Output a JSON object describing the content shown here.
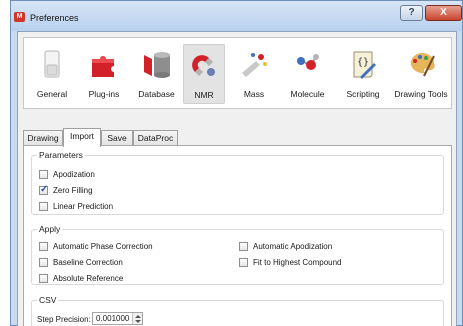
{
  "window": {
    "title": "Preferences",
    "app_icon": "mnova-app-icon",
    "help_label": "?",
    "close_label": "X"
  },
  "categories": [
    {
      "label": "General",
      "icon": "switch-icon"
    },
    {
      "label": "Plug-ins",
      "icon": "puzzle-icon"
    },
    {
      "label": "Database",
      "icon": "database-icon"
    },
    {
      "label": "NMR",
      "icon": "magnet-icon",
      "selected": true
    },
    {
      "label": "Mass",
      "icon": "mass-spec-icon"
    },
    {
      "label": "Molecule",
      "icon": "molecule-icon"
    },
    {
      "label": "Scripting",
      "icon": "script-icon"
    },
    {
      "label": "Drawing Tools",
      "icon": "palette-icon"
    }
  ],
  "tabs": [
    {
      "label": "Drawing",
      "active": false
    },
    {
      "label": "Import",
      "active": true
    },
    {
      "label": "Save",
      "active": false
    },
    {
      "label": "DataProc",
      "active": false
    }
  ],
  "parameters": {
    "title": "Parameters",
    "items": [
      {
        "label": "Apodization",
        "checked": false
      },
      {
        "label": "Zero Filling",
        "checked": true
      },
      {
        "label": "Linear Prediction",
        "checked": false
      }
    ]
  },
  "apply": {
    "title": "Apply",
    "items": [
      {
        "label": "Automatic Phase Correction",
        "checked": false
      },
      {
        "label": "Baseline Correction",
        "checked": false
      },
      {
        "label": "Absolute Reference",
        "checked": false
      },
      {
        "label": "Automatic Apodization",
        "checked": false
      },
      {
        "label": "Fit to Highest Compound",
        "checked": false
      }
    ]
  },
  "csv": {
    "title": "CSV",
    "step_label": "Step Precision:",
    "step_value": "0.001000"
  },
  "colors": {
    "title_bar": "#c7daf0",
    "close_button": "#c9442e",
    "tick": "#2a52a6"
  }
}
